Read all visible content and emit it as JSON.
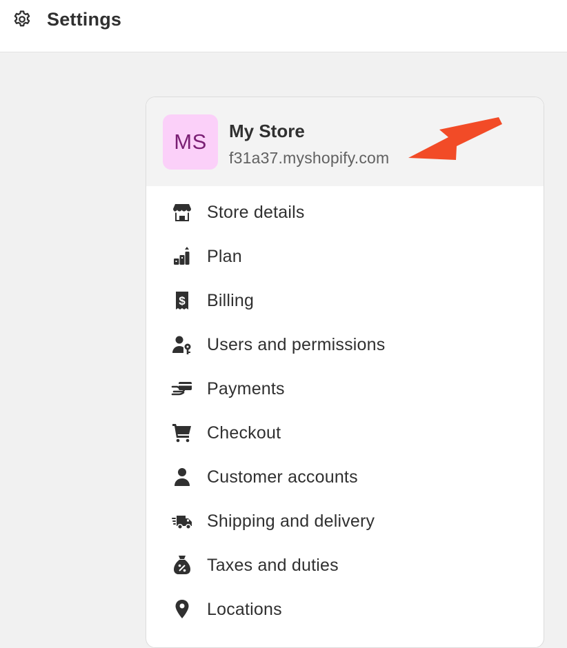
{
  "header": {
    "title": "Settings",
    "icon": "gear-icon"
  },
  "store": {
    "initials": "MS",
    "name": "My Store",
    "domain": "f31a37.myshopify.com",
    "avatar_bg": "#fbd0f9",
    "avatar_fg": "#7a1f74"
  },
  "menu": {
    "items": [
      {
        "label": "Store details",
        "icon": "store-icon"
      },
      {
        "label": "Plan",
        "icon": "plan-icon"
      },
      {
        "label": "Billing",
        "icon": "billing-receipt-icon"
      },
      {
        "label": "Users and permissions",
        "icon": "user-key-icon"
      },
      {
        "label": "Payments",
        "icon": "payment-hand-icon"
      },
      {
        "label": "Checkout",
        "icon": "cart-icon"
      },
      {
        "label": "Customer accounts",
        "icon": "person-icon"
      },
      {
        "label": "Shipping and delivery",
        "icon": "truck-icon"
      },
      {
        "label": "Taxes and duties",
        "icon": "tax-bag-icon"
      },
      {
        "label": "Locations",
        "icon": "location-pin-icon"
      }
    ]
  },
  "annotation": {
    "icon": "arrow-icon",
    "color": "#f24b27"
  }
}
